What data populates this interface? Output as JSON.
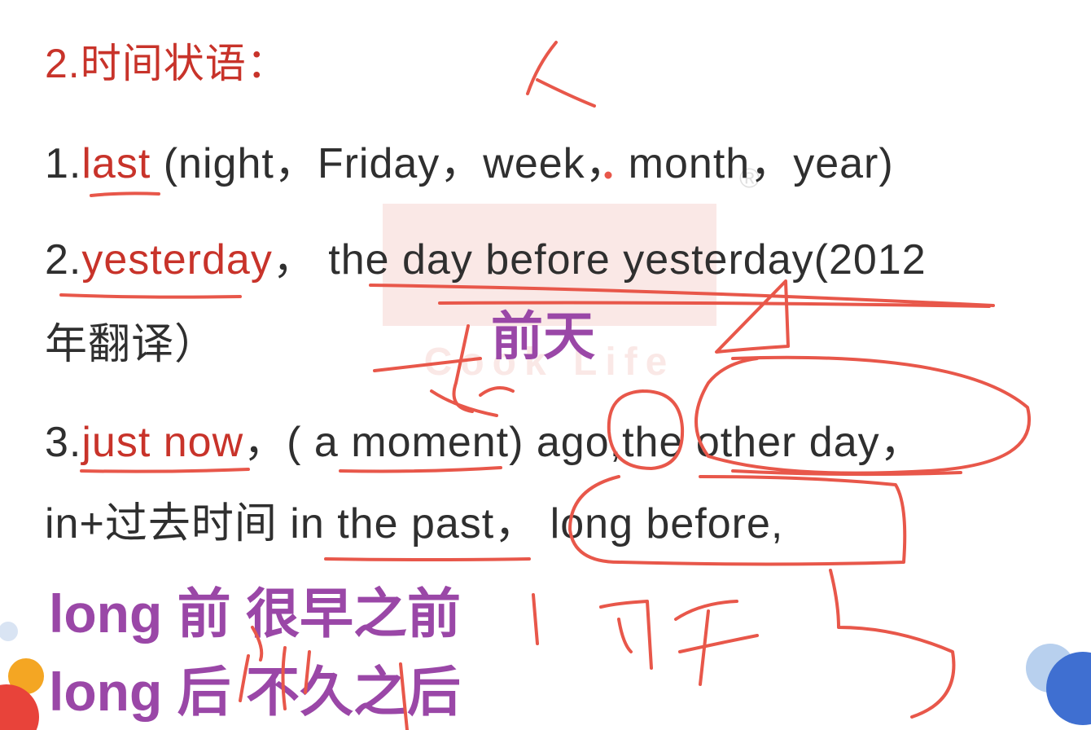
{
  "heading": "2.时间状语：",
  "items": [
    {
      "num": "1.",
      "keyword": "last",
      "rest": " (night，Friday，week，month，year)"
    },
    {
      "num": "2.",
      "keyword": "yesterday",
      "rest": "， the day before yesterday(2012",
      "cont": "年翻译）"
    },
    {
      "num": "3.",
      "keyword": "just now",
      "rest": "，( a moment) ago,the other day，",
      "cont": "in+过去时间 in the past， long before,"
    }
  ],
  "annotations": {
    "qiantian": "前天",
    "long_before": "long 前  很早之前",
    "long_after": "long 后   不久之后"
  },
  "watermark": {
    "text": "Cook Life",
    "registered": "®"
  },
  "colors": {
    "keyword": "#c8332a",
    "annotation": "#9a47a7",
    "ink": "#e8574a",
    "text": "#2f2f2f"
  }
}
